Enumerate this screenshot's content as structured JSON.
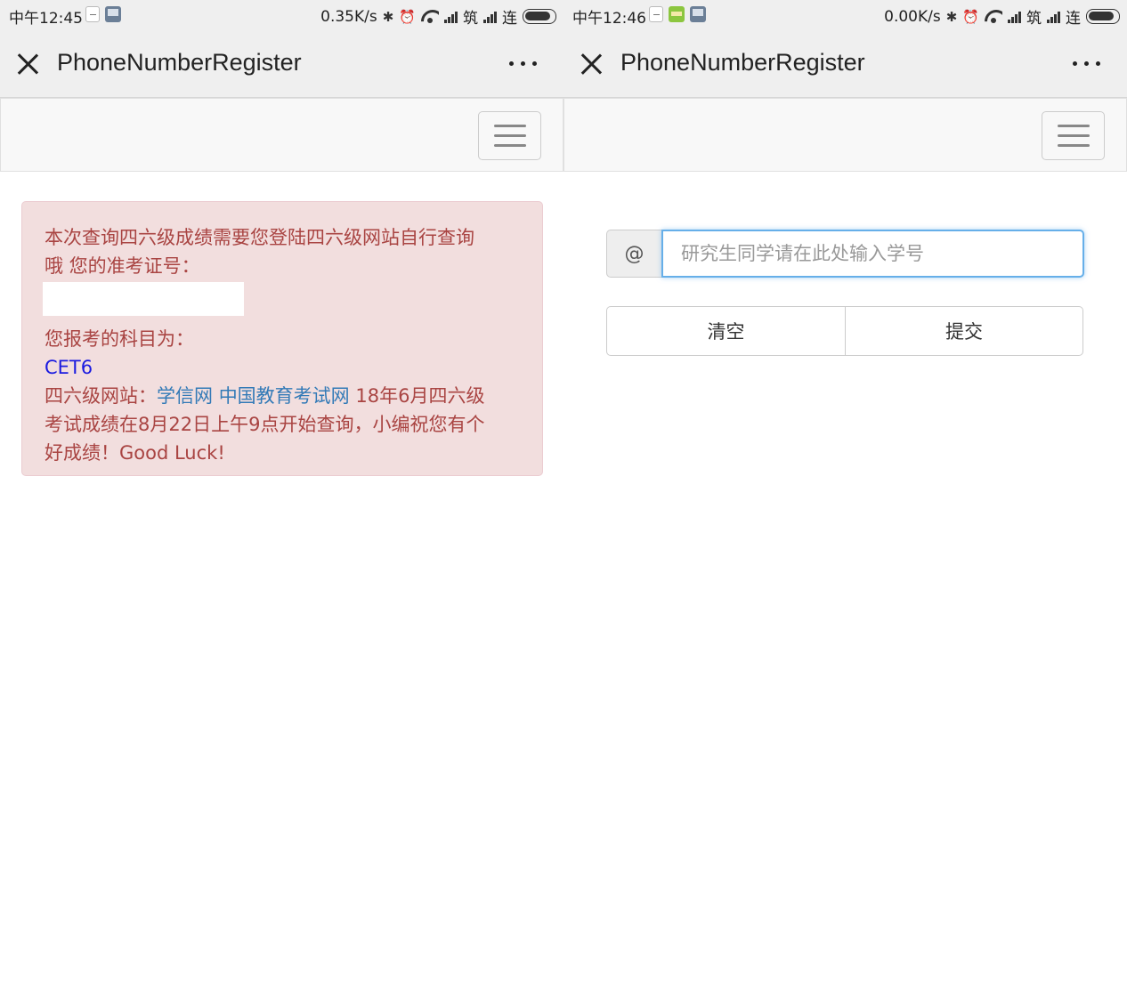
{
  "left": {
    "status": {
      "time": "中午12:45",
      "net_speed": "0.35K/s",
      "carrier1": "筑",
      "carrier2": "连"
    },
    "titlebar": {
      "title": "PhoneNumberRegister"
    },
    "alert": {
      "line1": "本次查询四六级成绩需要您登陆四六级网站自行查询",
      "line2": "哦 您的准考证号：",
      "line3": "您报考的科目为：",
      "subject": "CET6",
      "sites_prefix": "四六级网站：",
      "link1": "学信网",
      "link2": "中国教育考试网",
      "sites_suffix": " 18年6月四六级",
      "line5": "考试成绩在8月22日上午9点开始查询，小编祝您有个",
      "line6": "好成绩！Good Luck!"
    }
  },
  "right": {
    "status": {
      "time": "中午12:46",
      "net_speed": "0.00K/s",
      "carrier1": "筑",
      "carrier2": "连"
    },
    "titlebar": {
      "title": "PhoneNumberRegister"
    },
    "form": {
      "addon": "@",
      "placeholder": "研究生同学请在此处输入学号",
      "value": "",
      "clear_label": "清空",
      "submit_label": "提交"
    }
  },
  "colors": {
    "alert_bg": "#f2dede",
    "alert_text": "#a94442",
    "link": "#337ab7",
    "subject": "#1a1ae0",
    "focus": "#66afe9"
  }
}
